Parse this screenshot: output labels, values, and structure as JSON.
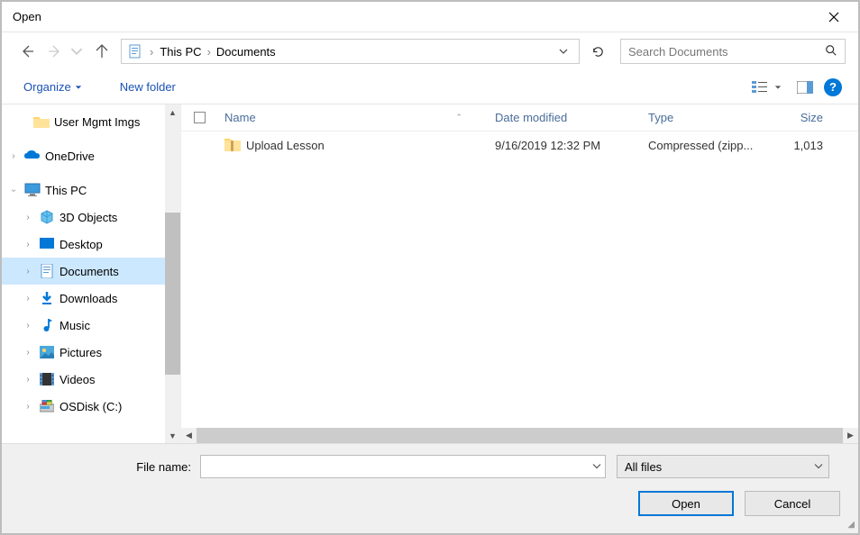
{
  "window": {
    "title": "Open"
  },
  "nav": {
    "breadcrumb": [
      "This PC",
      "Documents"
    ],
    "search_placeholder": "Search Documents"
  },
  "toolbar": {
    "organize": "Organize",
    "new_folder": "New folder"
  },
  "tree": {
    "scrolled_top": "User Mgmt Imgs",
    "onedrive": "OneDrive",
    "thispc": "This PC",
    "items": [
      "3D Objects",
      "Desktop",
      "Documents",
      "Downloads",
      "Music",
      "Pictures",
      "Videos",
      "OSDisk (C:)"
    ]
  },
  "columns": {
    "name": "Name",
    "date": "Date modified",
    "type": "Type",
    "size": "Size"
  },
  "files": [
    {
      "name": "Upload Lesson",
      "date": "9/16/2019 12:32 PM",
      "type": "Compressed (zipp...",
      "size": "1,013"
    }
  ],
  "footer": {
    "label": "File name:",
    "filter": "All files",
    "open": "Open",
    "cancel": "Cancel"
  }
}
